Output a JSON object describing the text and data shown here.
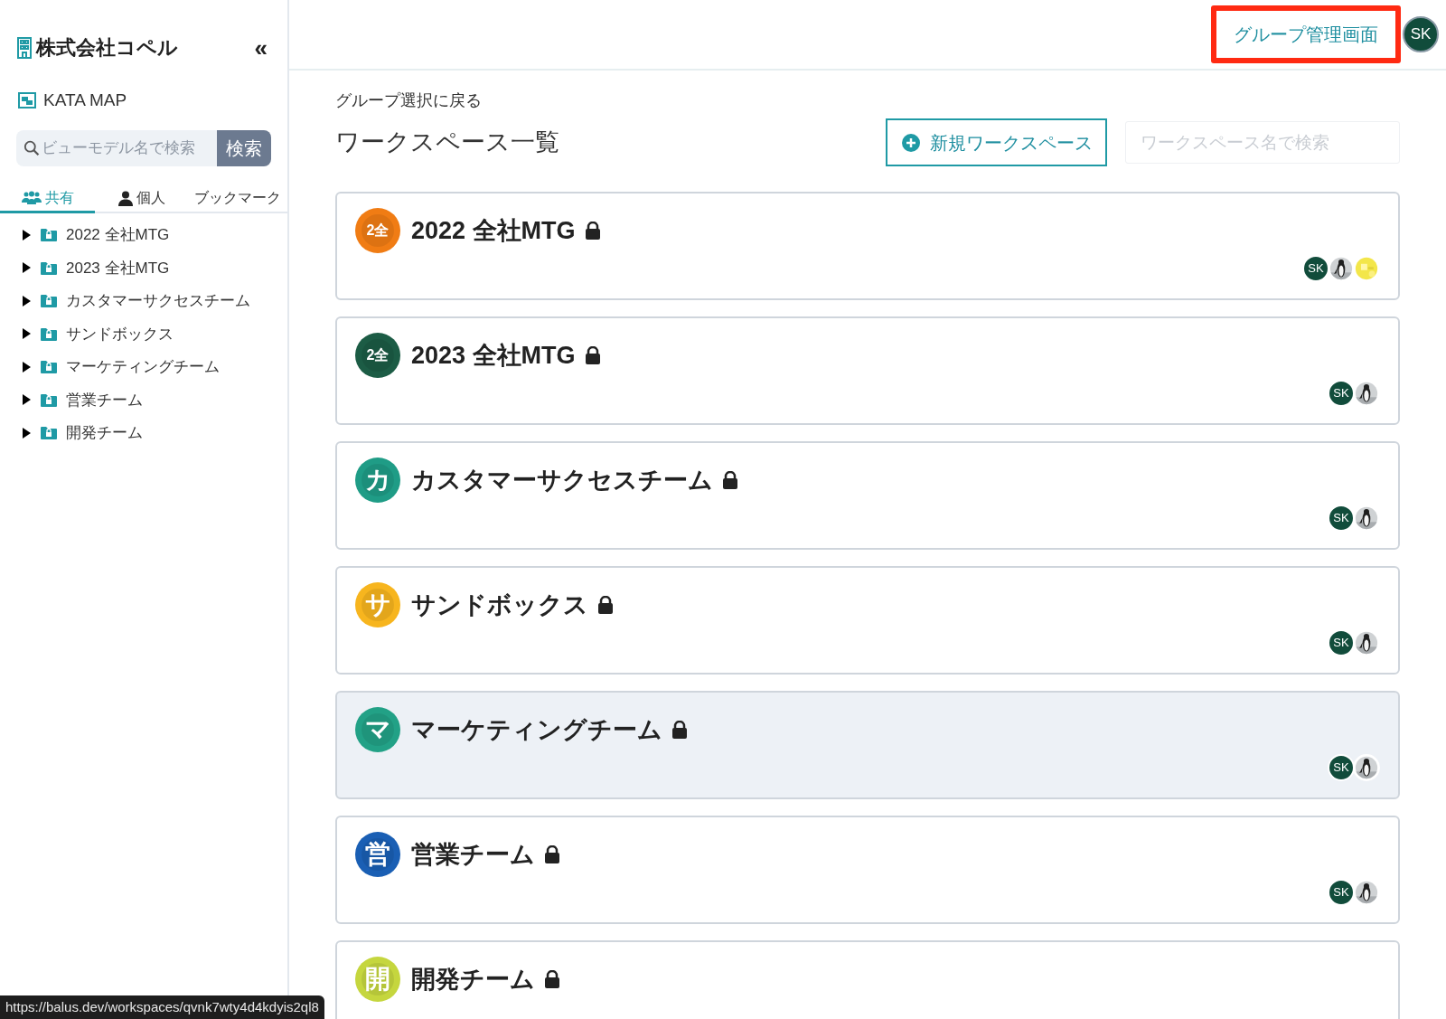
{
  "sidebar": {
    "company": "株式会社コペル",
    "collapse_label": "«",
    "app_name": "KATA MAP",
    "search": {
      "placeholder": "ビューモデル名で検索",
      "button": "検索"
    },
    "tabs": [
      {
        "kind": "group",
        "label": "共有",
        "selected": true
      },
      {
        "kind": "person",
        "label": "個人",
        "selected": false
      },
      {
        "kind": "plain",
        "label": "ブックマーク",
        "selected": false
      }
    ],
    "tree": [
      {
        "label": "2022 全社MTG",
        "expanded": false
      },
      {
        "label": "2023 全社MTG",
        "expanded": false
      },
      {
        "label": "カスタマーサクセスチーム",
        "expanded": false
      },
      {
        "label": "サンドボックス",
        "expanded": false
      },
      {
        "label": "マーケティングチーム",
        "expanded": false
      },
      {
        "label": "営業チーム",
        "expanded": false
      },
      {
        "label": "開発チーム",
        "expanded": false
      }
    ]
  },
  "header": {
    "link": {
      "label": "グループ管理画面",
      "annotated": true
    },
    "avatar": "SK"
  },
  "back_link": "グループ選択に戻る",
  "title": "ワークスペース一覧",
  "new_button": "新規ワークスペース",
  "search": {
    "placeholder": "ワークスペース名で検索"
  },
  "workspaces": [
    {
      "badge": "2全",
      "color": "#f07c14",
      "name": "2022 全社MTG",
      "locked": true,
      "highlighted": false,
      "members": [
        {
          "kind": "initials",
          "text": "SK"
        },
        {
          "kind": "picture"
        },
        {
          "kind": "picture"
        }
      ]
    },
    {
      "badge": "2全",
      "color": "#1c5c45",
      "name": "2023 全社MTG",
      "locked": true,
      "highlighted": false,
      "members": [
        {
          "kind": "initials",
          "text": "SK"
        },
        {
          "kind": "picture"
        }
      ]
    },
    {
      "badge": "カ",
      "color": "#1f9c86",
      "name": "カスタマーサクセスチーム",
      "locked": true,
      "highlighted": false,
      "members": [
        {
          "kind": "initials",
          "text": "SK"
        },
        {
          "kind": "picture"
        }
      ]
    },
    {
      "badge": "サ",
      "color": "#f7b51e",
      "name": "サンドボックス",
      "locked": true,
      "highlighted": false,
      "members": [
        {
          "kind": "initials",
          "text": "SK"
        },
        {
          "kind": "picture"
        }
      ]
    },
    {
      "badge": "マ",
      "color": "#22a186",
      "name": "マーケティングチーム",
      "locked": true,
      "highlighted": true,
      "members": [
        {
          "kind": "initials",
          "text": "SK"
        },
        {
          "kind": "picture"
        }
      ]
    },
    {
      "badge": "営",
      "color": "#1a5fb4",
      "name": "営業チーム",
      "locked": true,
      "highlighted": false,
      "members": [
        {
          "kind": "initials",
          "text": "SK"
        },
        {
          "kind": "picture"
        }
      ]
    },
    {
      "badge": "開",
      "color": "#c5d63e",
      "name": "開発チーム",
      "locked": true,
      "highlighted": false
    }
  ],
  "status_url": "https://balus.dev/workspaces/qvnk7wty4d4kdyis2ql8"
}
